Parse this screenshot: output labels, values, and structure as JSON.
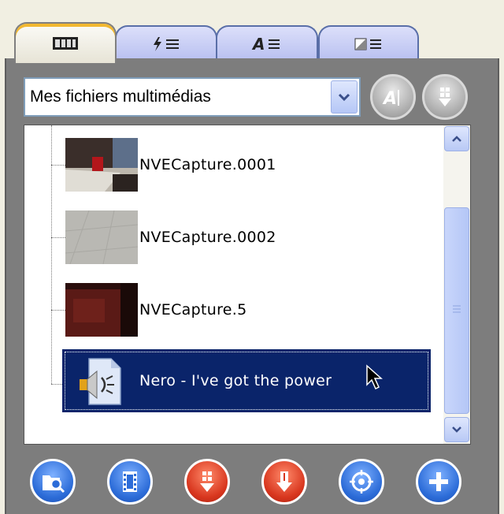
{
  "tabs": [
    {
      "name": "media",
      "icon": "film-strip-icon",
      "active": true
    },
    {
      "name": "effects",
      "icon": "lightning-list-icon",
      "active": false
    },
    {
      "name": "text",
      "icon": "text-list-icon",
      "active": false
    },
    {
      "name": "transitions",
      "icon": "transition-list-icon",
      "active": false
    }
  ],
  "media_dropdown": {
    "selected": "Mes fichiers multimédias"
  },
  "side_buttons": [
    "auto-text-icon",
    "download-grid-icon"
  ],
  "items": [
    {
      "label": "NVECapture.0001",
      "thumb": "desk-photo"
    },
    {
      "label": "NVECapture.0002",
      "thumb": "floor-photo"
    },
    {
      "label": "NVECapture.5",
      "thumb": "dark-red-photo"
    }
  ],
  "selected_item": {
    "label": "Nero -  I've got the power",
    "icon": "audio-file-icon"
  },
  "scrollbar": {
    "position": 0.55
  },
  "bottom_buttons": [
    {
      "name": "browse",
      "icon": "folder-search-icon",
      "color": "#2c6cd8"
    },
    {
      "name": "video",
      "icon": "film-icon",
      "color": "#2c6cd8"
    },
    {
      "name": "import-grid",
      "icon": "grid-down-icon",
      "color": "#d8361e"
    },
    {
      "name": "import-down",
      "icon": "arrow-down-icon",
      "color": "#d8361e"
    },
    {
      "name": "capture",
      "icon": "target-icon",
      "color": "#2c6cd8"
    },
    {
      "name": "add",
      "icon": "plus-icon",
      "color": "#2c6cd8"
    }
  ],
  "colors": {
    "selection": "#0a246a",
    "panel": "#7d7d7d",
    "tab_accent": "#f2b830"
  }
}
